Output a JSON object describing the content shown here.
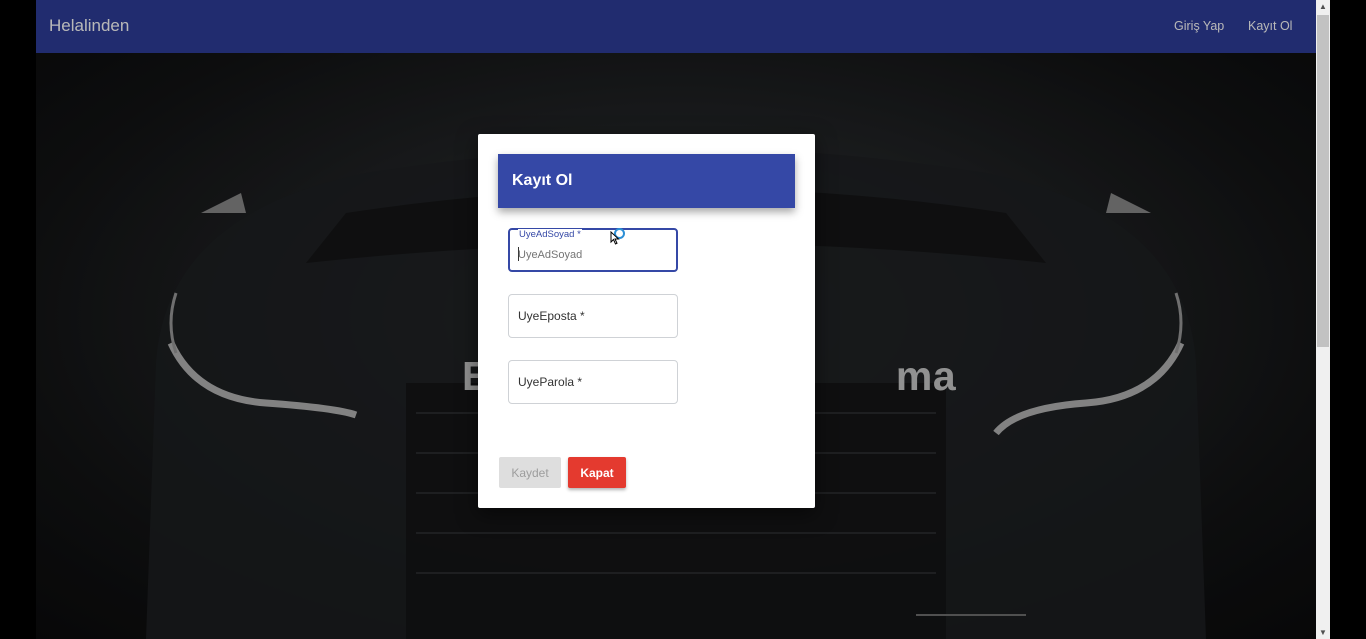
{
  "navbar": {
    "brand": "Helalinden",
    "links": [
      "Giriş Yap",
      "Kayıt Ol"
    ]
  },
  "hero": {
    "text": "En                                ma"
  },
  "modal": {
    "title": "Kayıt Ol",
    "fields": [
      {
        "label": "UyeAdSoyad *",
        "value": "",
        "placeholder": "UyeAdSoyad",
        "focused": true
      },
      {
        "label": "UyeEposta *",
        "value": ""
      },
      {
        "label": "UyeParola *",
        "value": ""
      }
    ],
    "buttons": {
      "save": "Kaydet",
      "close": "Kapat"
    }
  },
  "colors": {
    "navbar": "#2e3d9a",
    "modal_header": "#3548a6",
    "close_button": "#e43a2f",
    "save_button_disabled": "#dedede"
  }
}
